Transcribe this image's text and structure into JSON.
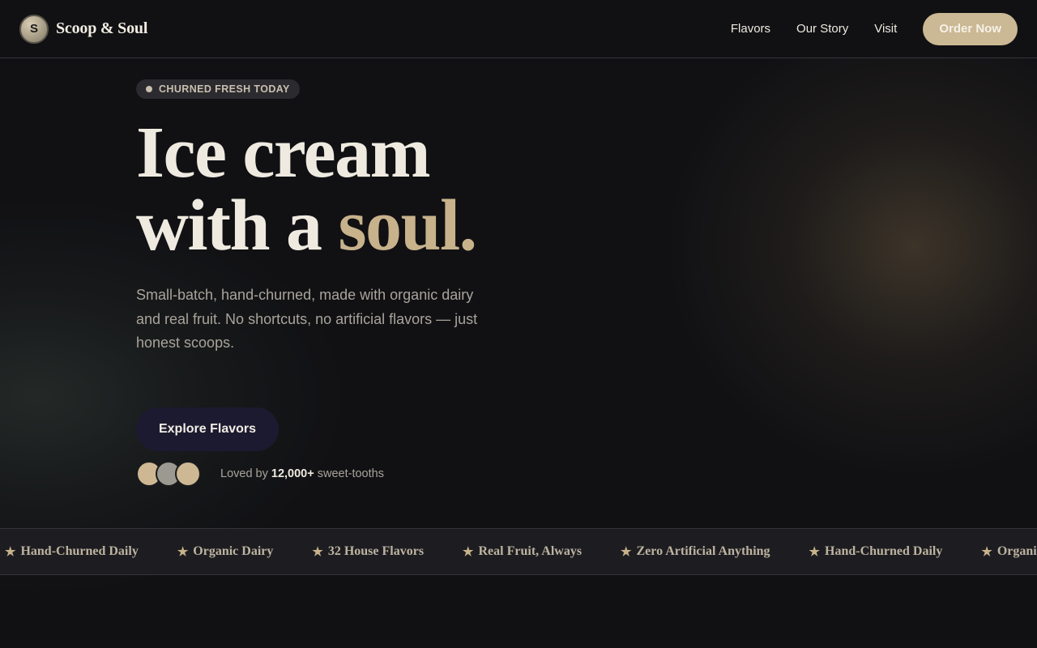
{
  "brand": {
    "mark": "S",
    "name": "Scoop & Soul"
  },
  "nav": {
    "links": [
      "Flavors",
      "Our Story",
      "Visit"
    ],
    "order_label": "Order Now"
  },
  "hero": {
    "badge": "CHURNED FRESH TODAY",
    "headline_line1": "Ice cream",
    "headline_line2_prefix": "with a ",
    "headline_accent": "soul.",
    "subcopy": "Small-batch, hand-churned, made with organic dairy and real fruit. No shortcuts, no artificial flavors — just honest scoops.",
    "cta_label": "Explore Flavors",
    "social_prefix": "Loved by ",
    "social_count": "12,000+",
    "social_suffix": " sweet-tooths"
  },
  "marquee": {
    "items": [
      "Hand-Churned Daily",
      "Organic Dairy",
      "32 House Flavors",
      "Real Fruit, Always",
      "Zero Artificial Anything",
      "Hand-Churned Daily",
      "Organic Dairy"
    ]
  },
  "colors": {
    "background": "#111114",
    "accent": "#c7b28b",
    "order_button": "#cbb894",
    "cta_button": "#1c1a30"
  }
}
